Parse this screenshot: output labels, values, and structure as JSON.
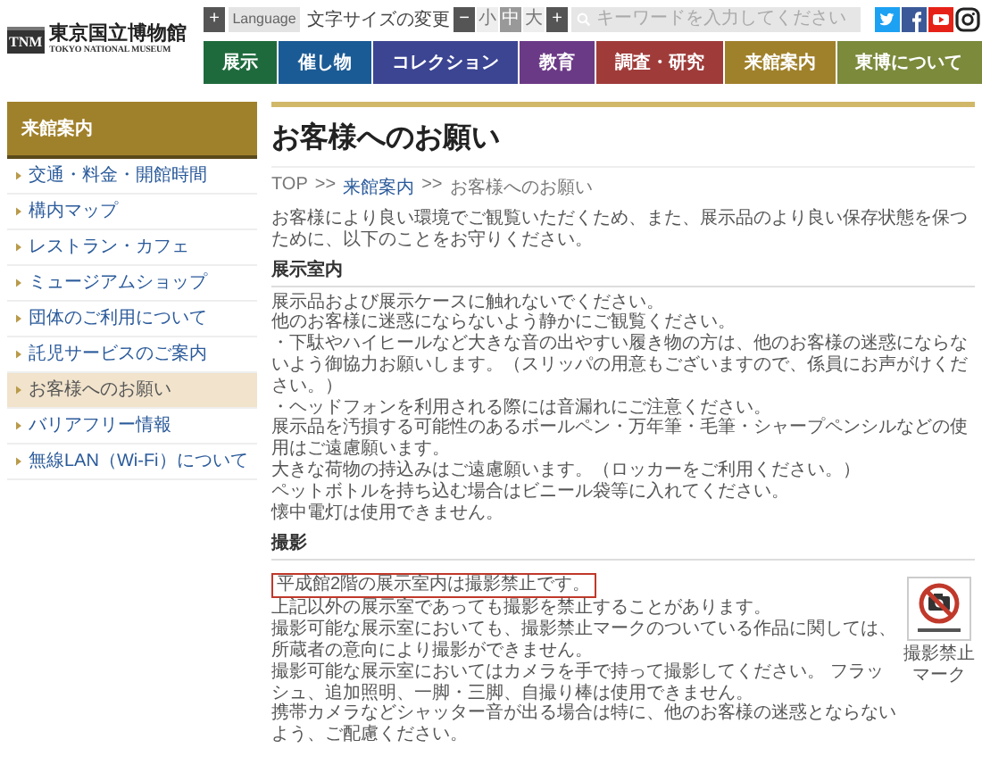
{
  "logo": {
    "mark": "TNM",
    "name": "東京国立博物館",
    "subtitle": "TOKYO NATIONAL MUSEUM"
  },
  "toolbar": {
    "language_button": "+",
    "language": "Language",
    "font_size_label": "文字サイズの変更",
    "font_size_buttons": [
      {
        "label": "−",
        "kind": "step"
      },
      {
        "label": "小",
        "kind": "size",
        "selected": false
      },
      {
        "label": "中",
        "kind": "size",
        "selected": true
      },
      {
        "label": "大",
        "kind": "size",
        "selected": false
      },
      {
        "label": "+",
        "kind": "step"
      }
    ],
    "search": {
      "placeholder": "キーワードを入力してください"
    },
    "social": [
      {
        "kind": "twitter",
        "color": "#1da1f2"
      },
      {
        "kind": "facebook",
        "color": "#3b5998"
      },
      {
        "kind": "youtube",
        "color": "#e62117"
      },
      {
        "kind": "instagram",
        "color": "#222222"
      }
    ]
  },
  "nav": [
    {
      "label": "展示",
      "color": "#1f6a3d"
    },
    {
      "label": "催し物",
      "color": "#1b5b95"
    },
    {
      "label": "コレクション",
      "color": "#3c4592"
    },
    {
      "label": "教育",
      "color": "#6b3a86"
    },
    {
      "label": "調査・研究",
      "color": "#9f3c3a"
    },
    {
      "label": "来館案内",
      "color": "#a0812b"
    },
    {
      "label": "東博について",
      "color": "#7b8a3b"
    }
  ],
  "sidebar": {
    "title": "来館案内",
    "items": [
      {
        "label": "交通・料金・開館時間",
        "selected": false
      },
      {
        "label": "構内マップ",
        "selected": false
      },
      {
        "label": "レストラン・カフェ",
        "selected": false
      },
      {
        "label": "ミュージアムショップ",
        "selected": false
      },
      {
        "label": "団体のご利用について",
        "selected": false
      },
      {
        "label": "託児サービスのご案内",
        "selected": false
      },
      {
        "label": "お客様へのお願い",
        "selected": true
      },
      {
        "label": "バリアフリー情報",
        "selected": false
      },
      {
        "label": "無線LAN（Wi-Fi）について",
        "selected": false
      }
    ]
  },
  "page_title": "お客様へのお願い",
  "breadcrumb": [
    {
      "label": "TOP",
      "link": false
    },
    {
      "label": "来館案内",
      "link": true
    },
    {
      "label": "お客様へのお願い",
      "link": false
    }
  ],
  "breadcrumb_separator": ">>",
  "intro": "お客様により良い環境でご観覧いただくため、また、展示品のより良い保存状態を保つために、以下のことをお守りください。",
  "sections": [
    {
      "heading": "展示室内",
      "lines": [
        {
          "text": "展示品および展示ケースに触れないでください。",
          "boxed": false
        },
        {
          "text": "他のお客様に迷惑にならないよう静かにご観覧ください。",
          "boxed": false
        },
        {
          "text": "・下駄やハイヒールなど大きな音の出やすい履き物の方は、他のお客様の迷惑にならないよう御協力お願いします。（スリッパの用意もございますので、係員にお声がけください。）",
          "boxed": false
        },
        {
          "text": "・ヘッドフォンを利用される際には音漏れにご注意ください。",
          "boxed": false
        },
        {
          "text": "展示品を汚損する可能性のあるボールペン・万年筆・毛筆・シャープペンシルなどの使用はご遠慮願います。",
          "boxed": false
        },
        {
          "text": "大きな荷物の持込みはご遠慮願います。（ロッカーをご利用ください。）",
          "boxed": false
        },
        {
          "text": "ペットボトルを持ち込む場合はビニール袋等に入れてください。",
          "boxed": false
        },
        {
          "text": "懐中電灯は使用できません。",
          "boxed": false
        }
      ]
    },
    {
      "heading": "撮影",
      "figure": {
        "caption": "撮影禁止マーク"
      },
      "lines": [
        {
          "text": "平成館2階の展示室内は撮影禁止です。",
          "boxed": true
        },
        {
          "text": "上記以外の展示室であっても撮影を禁止することがあります。",
          "boxed": false
        },
        {
          "text": "撮影可能な展示室においても、撮影禁止マークのついている作品に関しては、所蔵者の意向により撮影ができません。",
          "boxed": false
        },
        {
          "text": "撮影可能な展示室においてはカメラを手で持って撮影してください。 フラッシュ、追加照明、一脚・三脚、自撮り棒は使用できません。",
          "boxed": false
        },
        {
          "text": "携帯カメラなどシャッター音が出る場合は特に、他のお客様の迷惑とならないよう、ご配慮ください。",
          "boxed": false
        }
      ]
    }
  ]
}
